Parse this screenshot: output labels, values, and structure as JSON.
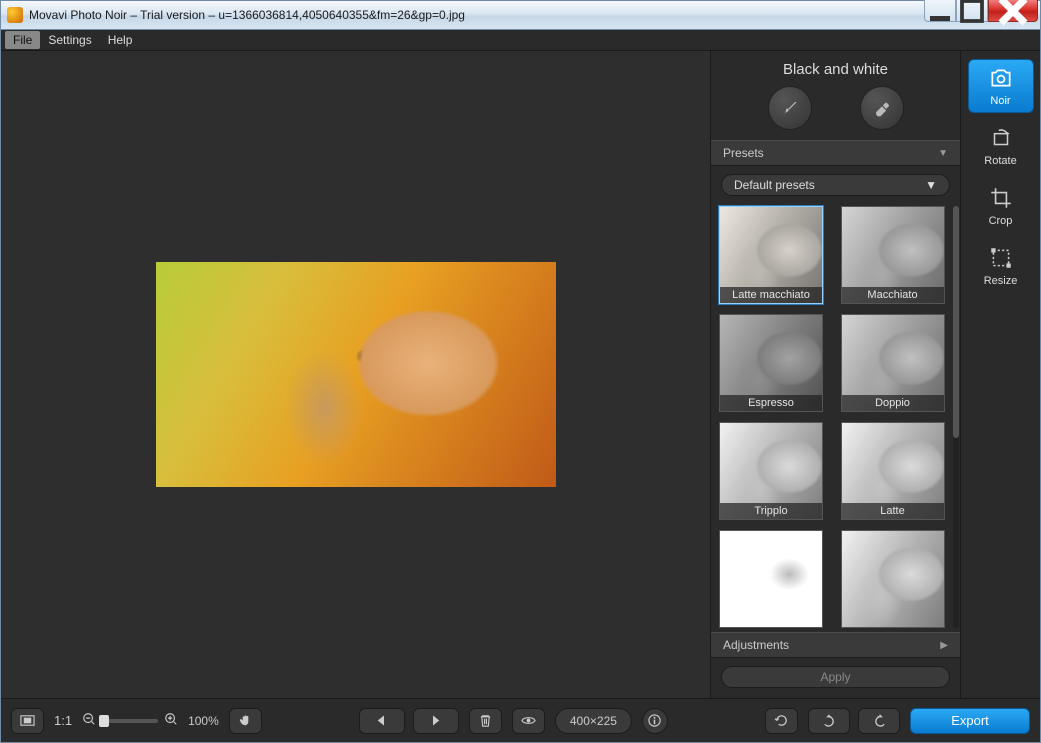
{
  "window": {
    "title": "Movavi Photo Noir – Trial version – u=1366036814,4050640355&fm=26&gp=0.jpg"
  },
  "menubar": {
    "file": "File",
    "settings": "Settings",
    "help": "Help"
  },
  "panel": {
    "title": "Black and white",
    "presets_label": "Presets",
    "dropdown_value": "Default presets",
    "adjustments_label": "Adjustments",
    "apply_label": "Apply",
    "presets": [
      {
        "label": "Latte macchiato",
        "variant": "warm",
        "selected": true
      },
      {
        "label": "Macchiato",
        "variant": "",
        "selected": false
      },
      {
        "label": "Espresso",
        "variant": "dark",
        "selected": false
      },
      {
        "label": "Doppio",
        "variant": "",
        "selected": false
      },
      {
        "label": "Tripplo",
        "variant": "light",
        "selected": false
      },
      {
        "label": "Latte",
        "variant": "light",
        "selected": false
      },
      {
        "label": "",
        "variant": "sketch",
        "selected": false
      },
      {
        "label": "",
        "variant": "light",
        "selected": false
      }
    ]
  },
  "tools": {
    "noir": "Noir",
    "rotate": "Rotate",
    "crop": "Crop",
    "resize": "Resize"
  },
  "bottombar": {
    "ratio": "1:1",
    "zoom_pct": "100%",
    "dimensions": "400×225",
    "export": "Export"
  }
}
